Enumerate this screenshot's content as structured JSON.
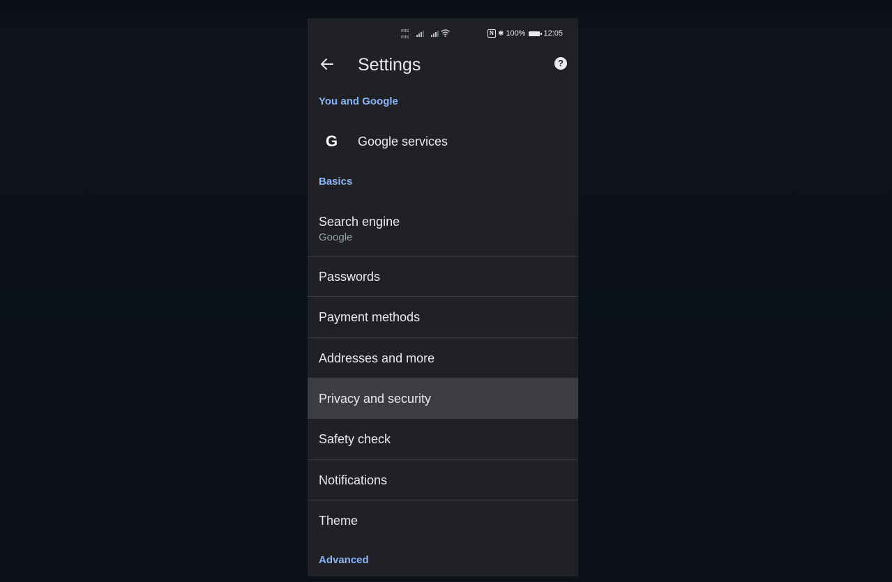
{
  "status_bar": {
    "carrier_1": "mts",
    "carrier_2": "mts",
    "battery": "100%",
    "time": "12:05"
  },
  "toolbar": {
    "title": "Settings",
    "back_icon": "arrow-left-icon",
    "help_icon": "help-circle-icon",
    "help_glyph": "?"
  },
  "sections": {
    "you_and_google": "You and Google",
    "basics": "Basics",
    "advanced": "Advanced"
  },
  "items": {
    "google_services": {
      "label": "Google services",
      "icon": "google-g-icon",
      "icon_glyph": "G"
    },
    "search_engine": {
      "label": "Search engine",
      "value": "Google"
    },
    "passwords": {
      "label": "Passwords"
    },
    "payment_methods": {
      "label": "Payment methods"
    },
    "addresses": {
      "label": "Addresses and more"
    },
    "privacy": {
      "label": "Privacy and security"
    },
    "safety_check": {
      "label": "Safety check"
    },
    "notifications": {
      "label": "Notifications"
    },
    "theme": {
      "label": "Theme"
    }
  },
  "colors": {
    "background": "#202124",
    "accent": "#8ab4f8",
    "highlight_row": "#3c3d40",
    "text": "#e8eaed"
  }
}
